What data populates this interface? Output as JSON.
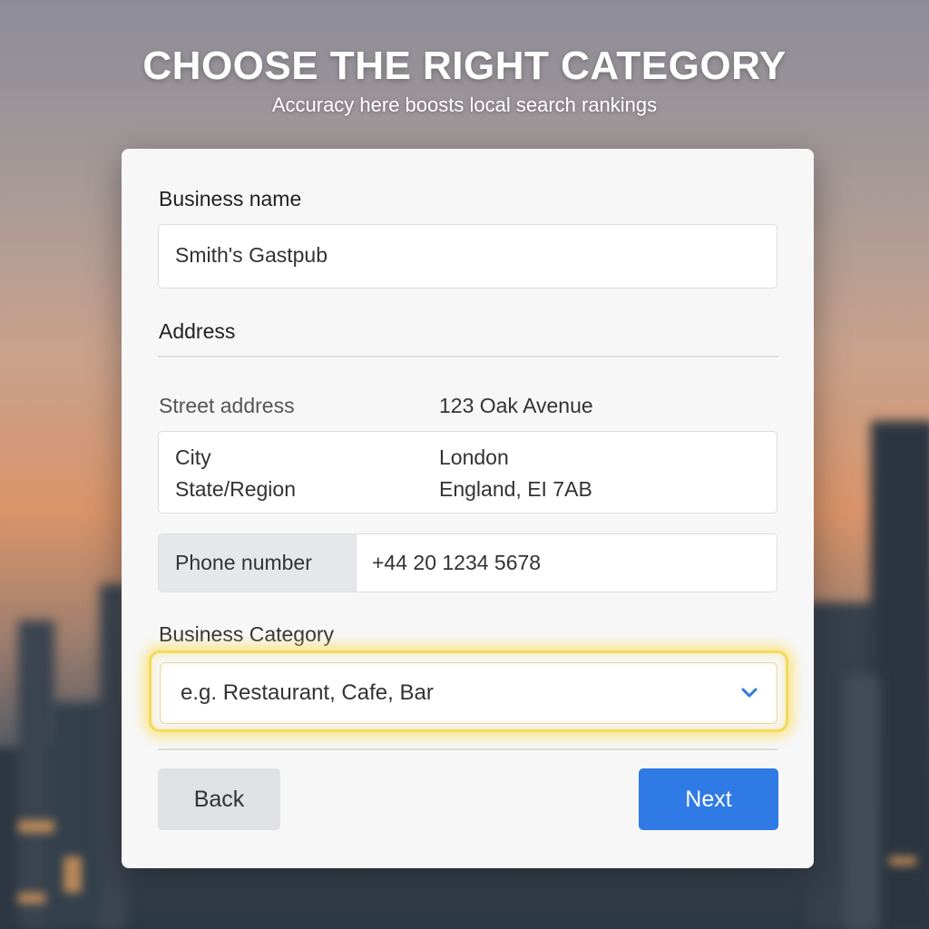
{
  "hero": {
    "title": "CHOOSE THE RIGHT CATEGORY",
    "subtitle": "Accuracy here boosts local search rankings"
  },
  "form": {
    "business_name": {
      "label": "Business name",
      "value": "Smith's Gastpub"
    },
    "address": {
      "heading": "Address",
      "street_label": "Street address",
      "street_value": "123 Oak Avenue",
      "city_label": "City",
      "city_value": "London",
      "region_label": "State/Region",
      "region_value": "England, EI 7AB"
    },
    "phone": {
      "label": "Phone number",
      "value": "+44 20 1234 5678"
    },
    "category": {
      "label": "Business Category",
      "placeholder": "e.g. Restaurant, Cafe, Bar",
      "highlight_color": "#f5d95c"
    },
    "buttons": {
      "back": "Back",
      "next": "Next"
    }
  },
  "colors": {
    "primary": "#2f7ae5",
    "chevron": "#2f7ae5"
  },
  "icons": {
    "dropdown": "chevron-down-icon"
  }
}
